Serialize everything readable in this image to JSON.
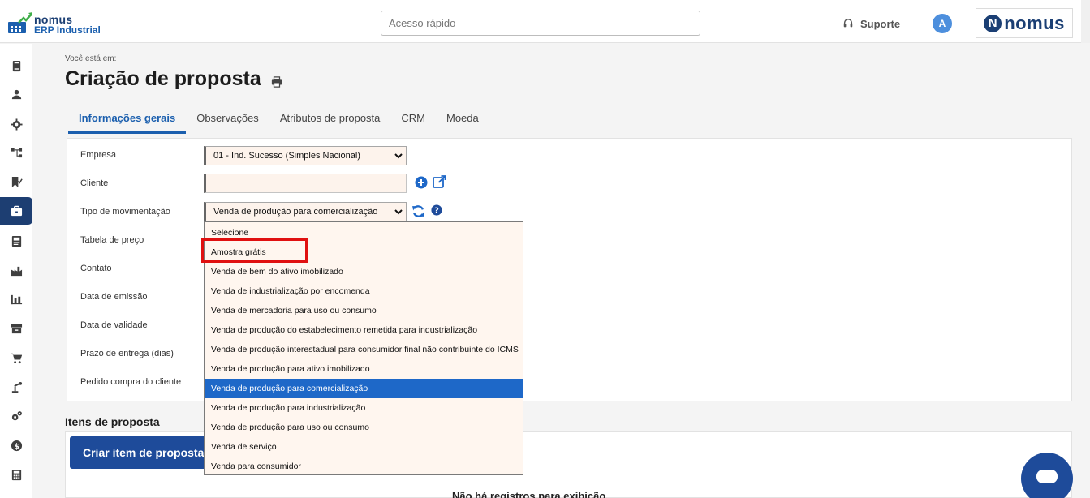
{
  "header": {
    "logo_line1": "nomus",
    "logo_line2": "ERP Industrial",
    "search_placeholder": "Acesso rápido",
    "support_label": "Suporte",
    "avatar_initial": "A",
    "brand_name": "nomus",
    "brand_mark": "N"
  },
  "sidebar": {
    "items": [
      {
        "icon": "book-icon"
      },
      {
        "icon": "user-icon"
      },
      {
        "icon": "gear-icon"
      },
      {
        "icon": "org-chart-icon"
      },
      {
        "icon": "bookmark-check-icon"
      },
      {
        "icon": "briefcase-icon",
        "active": true
      },
      {
        "icon": "document-icon"
      },
      {
        "icon": "factory-icon"
      },
      {
        "icon": "production-icon"
      },
      {
        "icon": "archive-icon"
      },
      {
        "icon": "cart-icon"
      },
      {
        "icon": "robot-arm-icon"
      },
      {
        "icon": "gears-icon"
      },
      {
        "icon": "dollar-icon"
      },
      {
        "icon": "calculator-icon"
      }
    ]
  },
  "breadcrumb": "Você está em:",
  "page_title": "Criação de proposta",
  "tabs": [
    {
      "label": "Informações gerais",
      "active": true
    },
    {
      "label": "Observações"
    },
    {
      "label": "Atributos de proposta"
    },
    {
      "label": "CRM"
    },
    {
      "label": "Moeda"
    }
  ],
  "form": {
    "empresa_label": "Empresa",
    "empresa_value": "01 - Ind. Sucesso (Simples Nacional)",
    "cliente_label": "Cliente",
    "cliente_value": "",
    "tipo_label": "Tipo de movimentação",
    "tipo_value": "Venda de produção para comercialização",
    "tabela_label": "Tabela de preço",
    "contato_label": "Contato",
    "emissao_label": "Data de emissão",
    "validade_label": "Data de validade",
    "prazo_label": "Prazo de entrega (dias)",
    "pedido_label": "Pedido compra do cliente"
  },
  "dropdown": {
    "options": [
      "Selecione",
      "Amostra grátis",
      "Venda de bem do ativo imobilizado",
      "Venda de industrialização por encomenda",
      "Venda de mercadoria para uso ou consumo",
      "Venda de produção do estabelecimento remetida para industrialização",
      "Venda de produção interestadual para consumidor final não contribuinte do ICMS",
      "Venda de produção para ativo imobilizado",
      "Venda de produção para comercialização",
      "Venda de produção para industrialização",
      "Venda de produção para uso ou consumo",
      "Venda de serviço",
      "Venda para consumidor"
    ],
    "selected_index": 8,
    "highlighted_option": "Amostra grátis"
  },
  "items_section": {
    "title": "Itens de proposta",
    "create_button": "Criar item de proposta",
    "empty_message": "Não há registros para exibição"
  },
  "colors": {
    "primary": "#1e4b9a",
    "selected_option": "#1e68c8",
    "highlight": "#e01010",
    "input_bg": "#fdf3ec"
  }
}
